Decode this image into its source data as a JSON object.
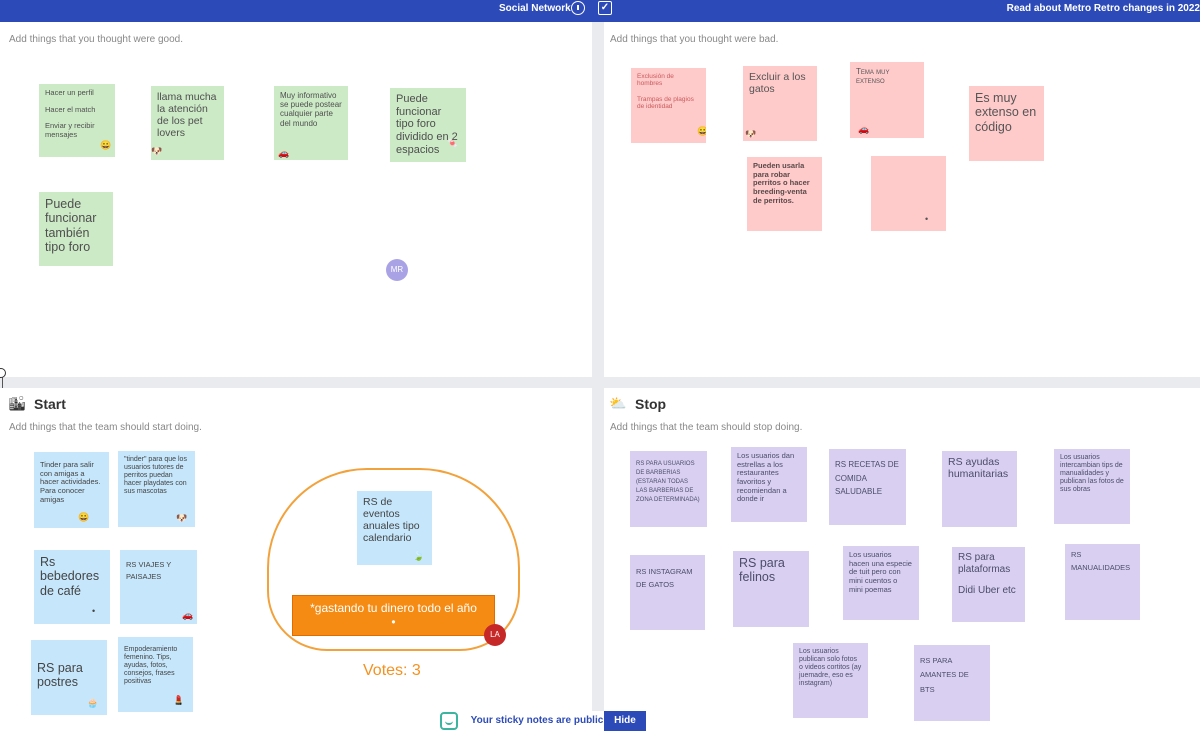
{
  "topbar": {
    "title": "Social Network",
    "timer_icon": "stopwatch-icon",
    "check_icon": "checkbox-icon",
    "news_link": "Read about Metro Retro changes in 2022"
  },
  "panels": {
    "good": {
      "subtitle": "Add things that you thought were good."
    },
    "bad": {
      "subtitle": "Add things that you thought were bad."
    },
    "start": {
      "title": "Start",
      "subtitle": "Add things that the team should start doing."
    },
    "stop": {
      "title": "Stop",
      "subtitle": "Add things that the team should stop doing."
    }
  },
  "good_notes": {
    "n1a": "Hacer un perfil",
    "n1b": "Hacer el match",
    "n1c": "Enviar y recibir mensajes",
    "n2": "llama mucha la atención de los pet lovers",
    "n3": "Muy informativo se puede postear cualquier parte del mundo",
    "n4": "Puede funcionar tipo foro dividido en 2 espacios",
    "n5": "Puede funcionar también tipo foro"
  },
  "bad_notes": {
    "n1a": "Exclusión de hombres",
    "n1b": "Trampas de plagios de identidad",
    "n2": "Excluir a los gatos",
    "n3": "Tema muy extenso",
    "n4": "Es muy extenso en código",
    "n5": "Pueden usarla para robar perritos o hacer breeding-venta de perritos.",
    "n6": ""
  },
  "start_notes": {
    "n1": "Tinder para salir con amigas a hacer actividades. Para conocer amigas",
    "n2": "\"tinder\" para que los usuarios tutores de perritos puedan hacer playdates con sus mascotas",
    "n3": "RS de eventos anuales tipo calendario",
    "n4": "Rs bebedores de café",
    "n5": "RS VIAJES Y PAISAJES",
    "n6": "*gastando tu dinero todo el año",
    "n6_dot": "•",
    "n7": "RS para postres",
    "n8": "Empoderamiento femenino. Tips, ayudas, fotos, consejos, frases positivas",
    "votes": "Votes: 3"
  },
  "stop_notes": {
    "n1": "RS PARA USUARIOS DE BARBERIAS (ESTARAN TODAS LAS BARBERIAS DE ZONA DETERMINADA)",
    "n2": "Los usuarios dan estrellas a los restaurantes favoritos y recomiendan a donde ir",
    "n3": "RS RECETAS DE COMIDA SALUDABLE",
    "n4": "RS ayudas humanitarias",
    "n5": "Los usuarios intercambian tips de manualidades y publican las fotos de sus obras",
    "n6": "RS INSTAGRAM DE GATOS",
    "n7": "RS para felinos",
    "n8": "Los usuarios hacen una especie de tuit pero con mini cuentos o mini poemas",
    "n9a": "RS para plataformas",
    "n9b": "Didi Uber etc",
    "n10": "RS MANUALIDADES",
    "n11": "Los usuarios publican solo fotos o videos cortitos (ay juemadre, eso es instagram)",
    "n12": "RS PARA AMANTES DE BTS"
  },
  "avatars": {
    "mr": "MR",
    "la": "LA"
  },
  "bottom": {
    "public_text": "Your sticky notes are public",
    "hide_label": "Hide"
  },
  "colors": {
    "brand": "#2d4bb8",
    "accent": "#f58b13",
    "green_note": "#cdeac7",
    "pink_note": "#ffcaca",
    "blue_note": "#c6e6fb",
    "purple_note": "#d9d0f1"
  }
}
